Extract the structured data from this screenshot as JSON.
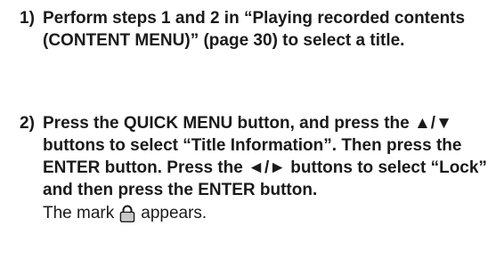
{
  "steps": [
    {
      "number": "1)",
      "instruction": "Perform steps 1 and 2 in “Playing recorded contents (CONTENT MENU)” (page 30) to select a title."
    },
    {
      "number": "2)",
      "instruction": "Press the QUICK MENU button, and press the ▲/▼ buttons to select “Title Information”. Then press the ENTER button.  Press the ◄/► buttons to select “Lock” and then press the ENTER button.",
      "result_before": "The mark",
      "result_icon": "lock-icon",
      "result_after": "appears."
    }
  ]
}
